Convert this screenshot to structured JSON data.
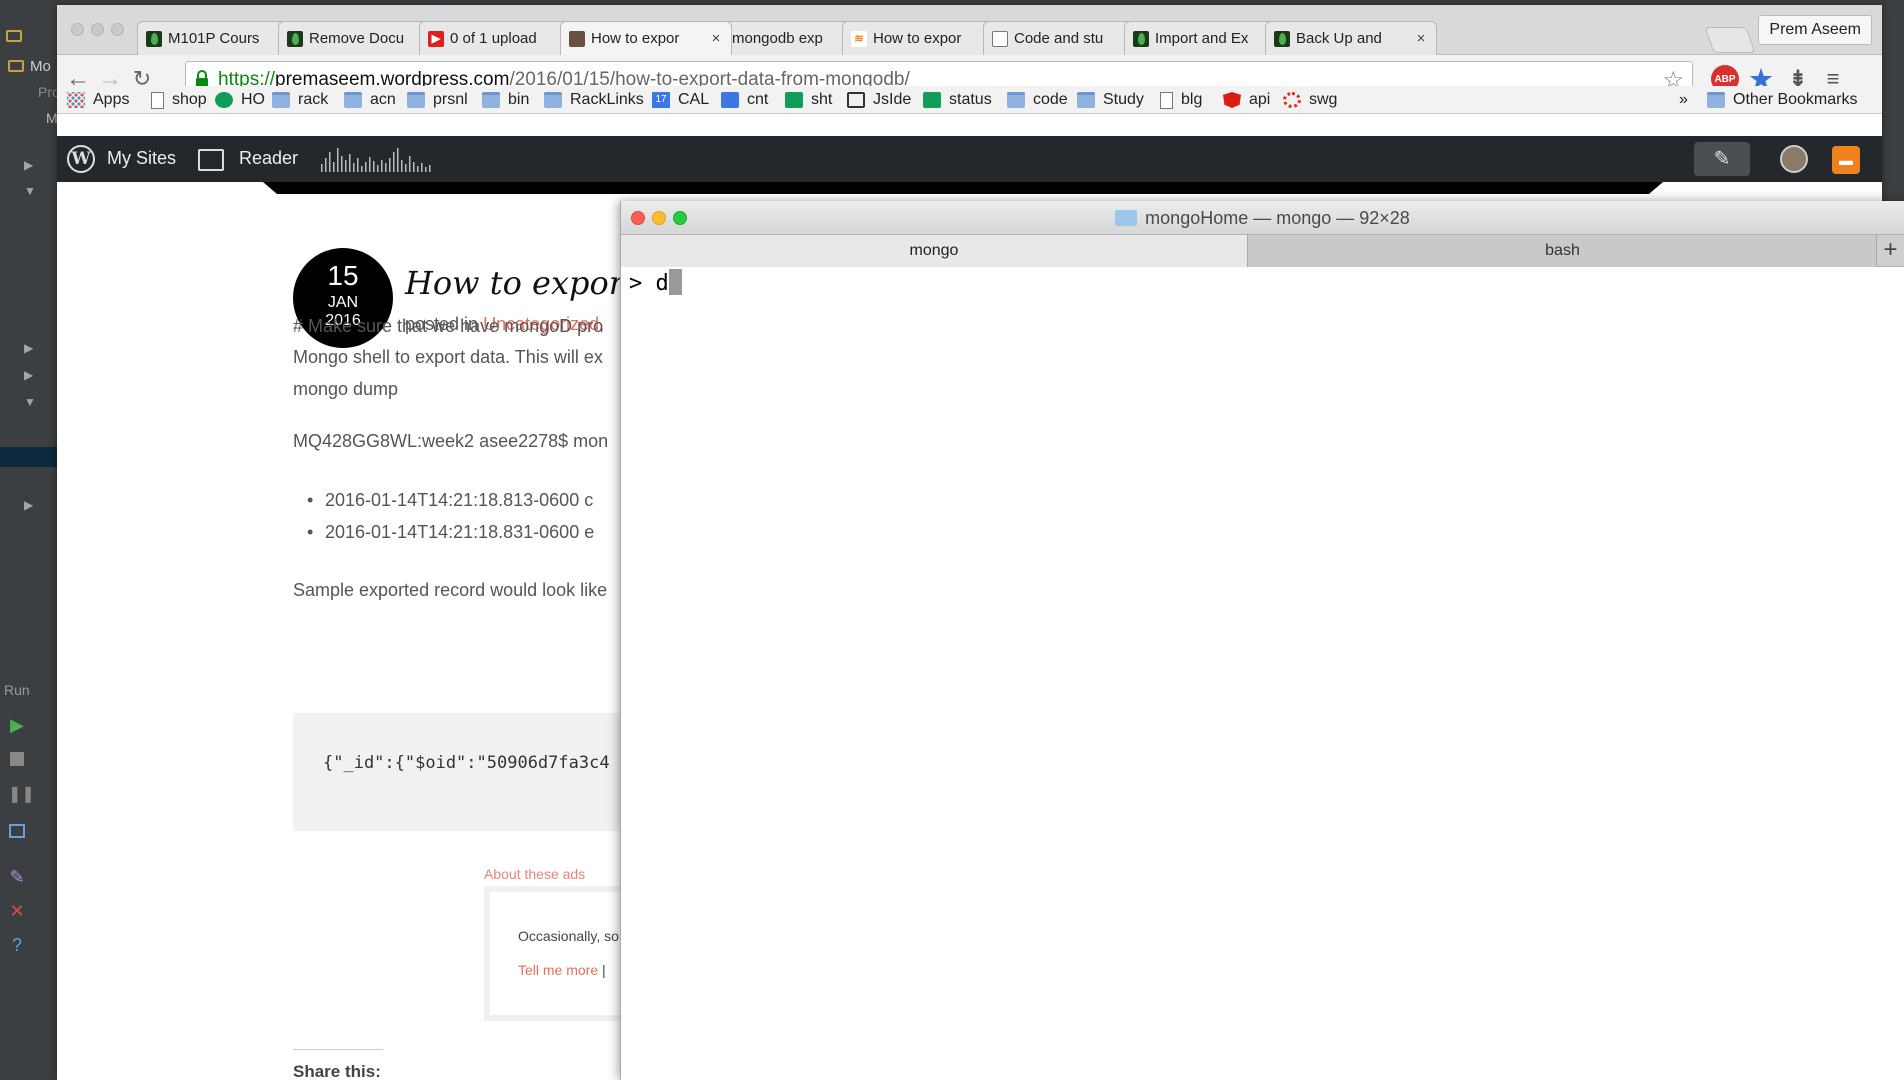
{
  "ide": {
    "labels": {
      "top_item": "Mo",
      "second_item": "Pro",
      "third_item": "M"
    },
    "run_label": "Run"
  },
  "browser": {
    "tabs": [
      {
        "title": "M101P Cours",
        "icon": "mongodb-leaf-icon"
      },
      {
        "title": "Remove Docu",
        "icon": "mongodb-leaf-icon"
      },
      {
        "title": "0 of 1 upload",
        "icon": "youtube-icon"
      },
      {
        "title": "How to expor",
        "icon": "avatar-icon"
      },
      {
        "title": "mongodb exp",
        "icon": "google-icon"
      },
      {
        "title": "How to expor",
        "icon": "stackoverflow-icon"
      },
      {
        "title": "Code and stu",
        "icon": "page-icon"
      },
      {
        "title": "Import and Ex",
        "icon": "mongodb-leaf-icon"
      },
      {
        "title": "Back Up and",
        "icon": "mongodb-leaf-icon"
      }
    ],
    "active_tab_index": 3,
    "profile_name": "Prem Aseem",
    "url": {
      "scheme": "https://",
      "host": "premaseem.wordpress.com",
      "path": "/2016/01/15/how-to-export-data-from-mongodb/"
    },
    "extensions": {
      "adblock_label": "ABP"
    },
    "bookmarks": [
      {
        "label": "Apps",
        "icon": "apps-grid-icon"
      },
      {
        "label": "shop",
        "icon": "page-icon"
      },
      {
        "label": "HO",
        "icon": "hangouts-icon"
      },
      {
        "label": "rack",
        "icon": "folder-icon"
      },
      {
        "label": "acn",
        "icon": "folder-icon"
      },
      {
        "label": "prsnl",
        "icon": "folder-icon"
      },
      {
        "label": "bin",
        "icon": "folder-icon"
      },
      {
        "label": "RackLinks",
        "icon": "folder-icon"
      },
      {
        "label": "CAL",
        "icon": "calendar-icon"
      },
      {
        "label": "cnt",
        "icon": "contacts-icon"
      },
      {
        "label": "sht",
        "icon": "sheets-icon"
      },
      {
        "label": "JsIde",
        "icon": "download-icon"
      },
      {
        "label": "status",
        "icon": "sheets-icon"
      },
      {
        "label": "code",
        "icon": "folder-icon"
      },
      {
        "label": "Study",
        "icon": "folder-icon"
      },
      {
        "label": "blg",
        "icon": "page-icon"
      },
      {
        "label": "api",
        "icon": "angular-icon"
      },
      {
        "label": "swg",
        "icon": "spinner-icon"
      }
    ],
    "bookmarks_overflow": "»",
    "other_bookmarks": "Other Bookmarks",
    "calendar_day": "17"
  },
  "wpbar": {
    "my_sites": "My Sites",
    "reader": "Reader"
  },
  "blog": {
    "date": {
      "day": "15",
      "month": "JAN",
      "year": "2016"
    },
    "title": "How to export",
    "meta_prefix": "posted in",
    "category": "Uncategorized",
    "meta_suffix": ",",
    "paragraph_lines": [
      "# Make sure that we have mongoD pro",
      "Mongo shell to export data. This will ex",
      "mongo dump"
    ],
    "command_line": "MQ428GG8WL:week2 asee2278$ mon",
    "bullets": [
      "2016-01-14T14:21:18.813-0600 c",
      "2016-01-14T14:21:18.831-0600 e"
    ],
    "sample_intro": "Sample exported record would look like",
    "code": "{\"_id\":{\"$oid\":\"50906d7fa3c4",
    "ads_label": "About these ads",
    "ad_text": "Occasionally, so",
    "ad_link": "Tell me more",
    "ad_link_sep": "|",
    "share_title": "Share this:"
  },
  "terminal": {
    "title": "mongoHome — mongo — 92×28",
    "tabs": [
      {
        "label": "mongo",
        "active": true
      },
      {
        "label": "bash",
        "active": false
      }
    ],
    "add_tab": "+",
    "prompt": "> ",
    "input": "d"
  },
  "colors": {
    "wp_accent": "#e26f5a",
    "wp_bar": "#23282d",
    "close_red": "#fc5f57",
    "minimize_yellow": "#fdbc2e",
    "zoom_green": "#28c840"
  }
}
